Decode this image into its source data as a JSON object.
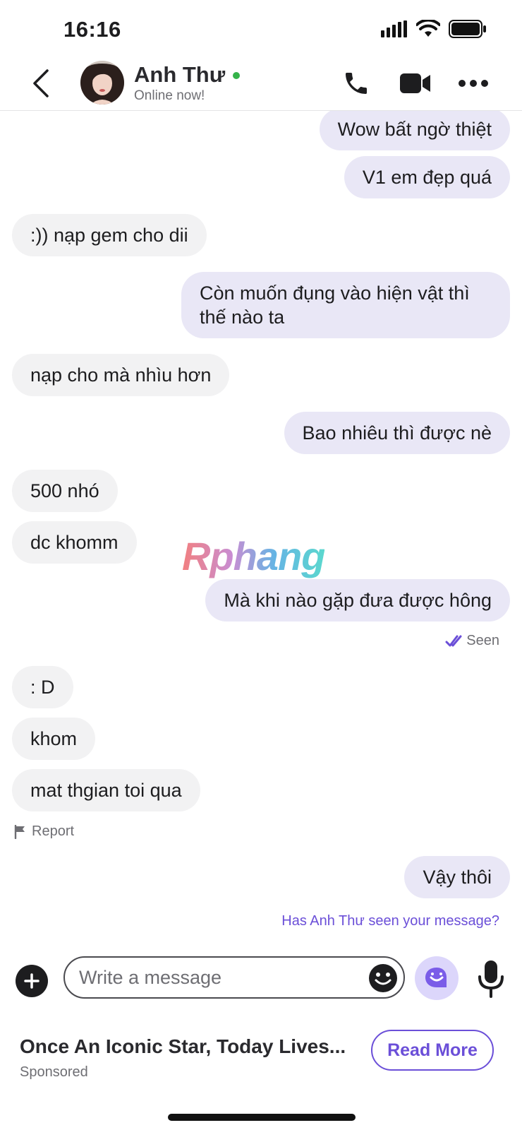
{
  "status_bar": {
    "time": "16:16"
  },
  "header": {
    "contact_name": "Anh Thư",
    "status": "Online now!"
  },
  "messages": [
    {
      "dir": "out",
      "text": "Wow bất ngờ thiệt"
    },
    {
      "dir": "out",
      "text": "V1 em đẹp quá"
    },
    {
      "dir": "in",
      "text": ":)) nạp gem cho dii"
    },
    {
      "dir": "out",
      "text": "Còn muốn đụng vào hiện vật thì thế nào ta"
    },
    {
      "dir": "in",
      "text": "nạp cho mà nhìu hơn"
    },
    {
      "dir": "out",
      "text": "Bao nhiêu thì được nè"
    },
    {
      "dir": "in",
      "text": "500 nhó"
    },
    {
      "dir": "in",
      "text": "dc khomm"
    },
    {
      "dir": "out",
      "text": "Mà khi nào gặp đưa được hông"
    },
    {
      "dir": "in",
      "text": ": D"
    },
    {
      "dir": "in",
      "text": "khom"
    },
    {
      "dir": "in",
      "text": "mat thgian toi qua"
    },
    {
      "dir": "out",
      "text": "Vậy thôi"
    }
  ],
  "watermark": "Rphang",
  "seen_label": "Seen",
  "report_label": "Report",
  "seen_question": "Has Anh Thư seen your message?",
  "composer": {
    "placeholder": "Write a message"
  },
  "ad": {
    "title": "Once An Iconic Star, Today Lives...",
    "sponsored": "Sponsored",
    "cta": "Read More"
  },
  "colors": {
    "accent": "#6b4fd8",
    "outgoing_bubble": "#e9e7f6",
    "incoming_bubble": "#f2f2f3",
    "online": "#35b34a"
  },
  "icons": [
    "back-icon",
    "phone-icon",
    "video-camera-icon",
    "more-icon",
    "plus-icon",
    "emoji-icon",
    "ai-assistant-icon",
    "microphone-icon",
    "flag-icon",
    "double-check-icon"
  ]
}
